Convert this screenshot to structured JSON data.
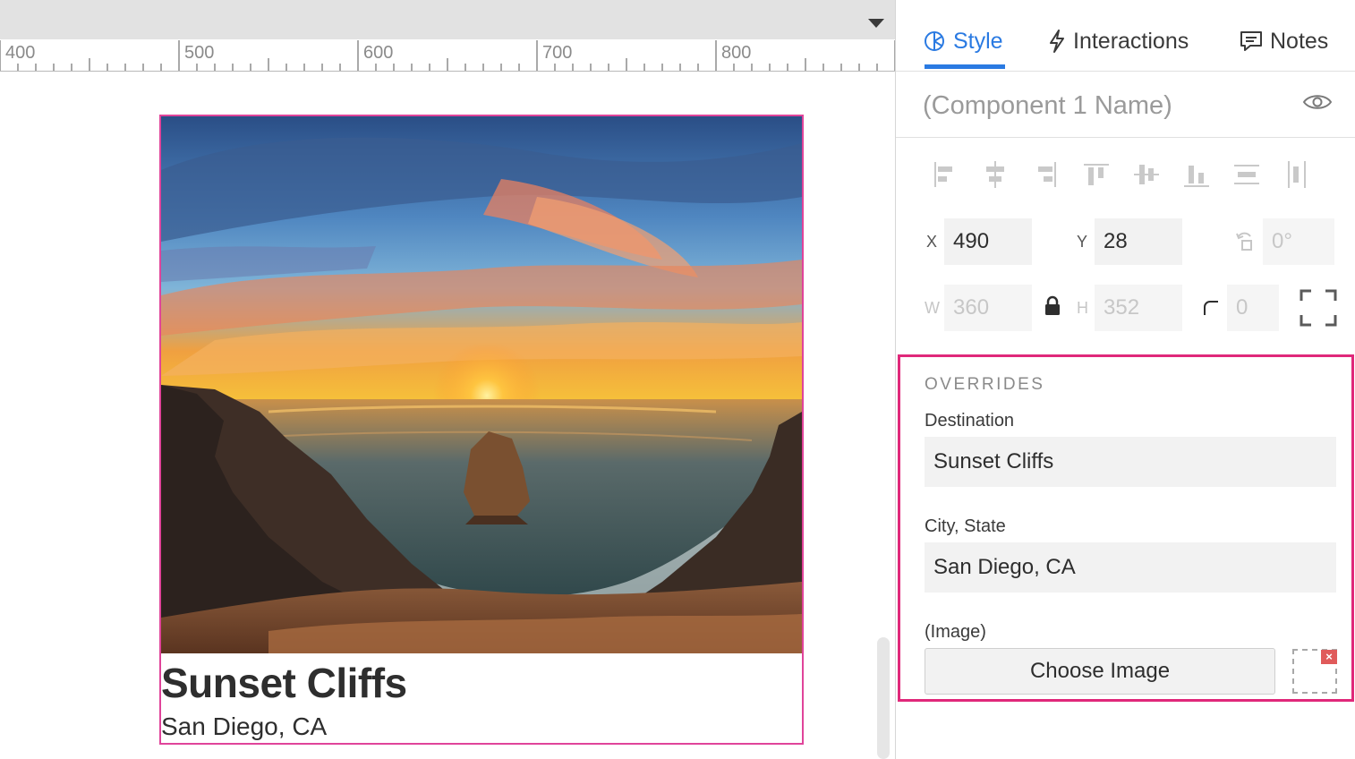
{
  "canvas": {
    "ruler_labels": [
      "400",
      "500",
      "600",
      "700",
      "800"
    ]
  },
  "card": {
    "title": "Sunset Cliffs",
    "subtitle": "San Diego, CA"
  },
  "panel": {
    "tabs": [
      {
        "label": "Style",
        "icon": "style-icon",
        "active": true
      },
      {
        "label": "Interactions",
        "icon": "lightning-icon",
        "active": false
      },
      {
        "label": "Notes",
        "icon": "notes-icon",
        "active": false
      }
    ],
    "component_name": "(Component 1 Name)",
    "geometry": {
      "x_label": "X",
      "x_value": "490",
      "y_label": "Y",
      "y_value": "28",
      "rotation_value": "0°",
      "w_label": "W",
      "w_value": "360",
      "h_label": "H",
      "h_value": "352",
      "radius_value": "0"
    },
    "overrides": {
      "title": "OVERRIDES",
      "destination_label": "Destination",
      "destination_value": "Sunset Cliffs",
      "city_label": "City, State",
      "city_value": "San Diego, CA",
      "image_label": "(Image)",
      "choose_image_label": "Choose Image",
      "remove_glyph": "×"
    }
  },
  "colors": {
    "accent": "#2a7ae2",
    "selection": "#e0449a",
    "overrides_border": "#e0287a"
  }
}
